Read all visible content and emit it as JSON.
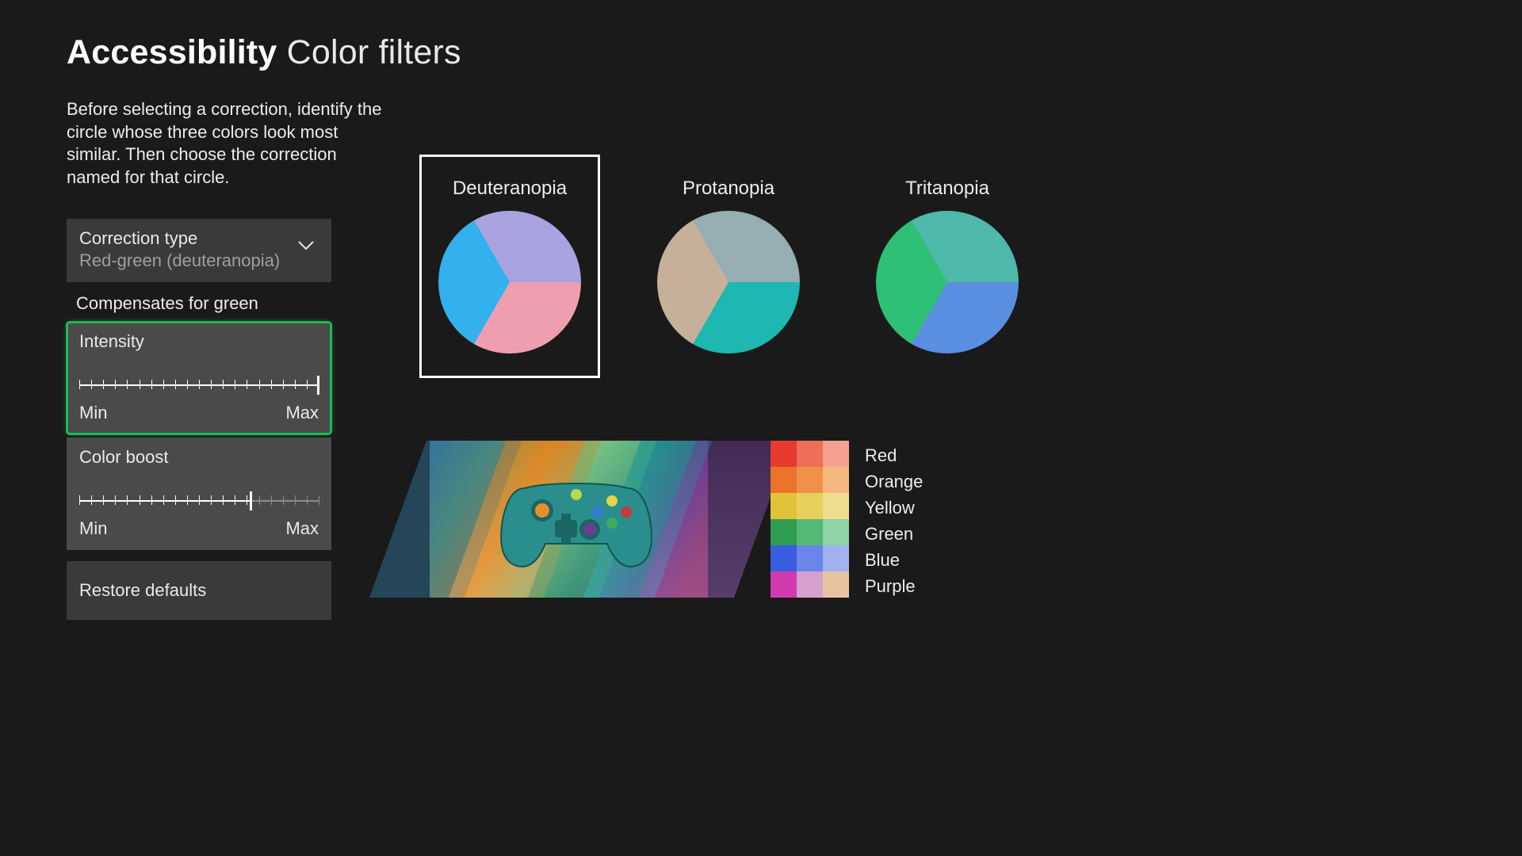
{
  "header": {
    "category": "Accessibility",
    "page": "Color filters"
  },
  "instructions": "Before selecting a correction, identify the circle whose three colors look most similar. Then choose the correction named for that circle.",
  "correction": {
    "label": "Correction type",
    "value": "Red-green (deuteranopia)",
    "description": "Compensates for green"
  },
  "intensity": {
    "label": "Intensity",
    "min_label": "Min",
    "max_label": "Max",
    "value_percent": 100,
    "selected": true
  },
  "color_boost": {
    "label": "Color boost",
    "min_label": "Min",
    "max_label": "Max",
    "value_percent": 72,
    "selected": false
  },
  "restore_label": "Restore defaults",
  "filters": [
    {
      "name": "Deuteranopia",
      "selected": true,
      "colors": [
        "#32b1ee",
        "#a9a4df",
        "#ef9eb0"
      ]
    },
    {
      "name": "Protanopia",
      "selected": false,
      "colors": [
        "#c7b09a",
        "#96adb2",
        "#1fb7b2"
      ]
    },
    {
      "name": "Tritanopia",
      "selected": false,
      "colors": [
        "#2ec076",
        "#4fb9a9",
        "#5a8ee0"
      ]
    }
  ],
  "swatches": {
    "rows": [
      {
        "label": "Red",
        "cells": [
          "#e63b2e",
          "#ef6e5a",
          "#f4a08f"
        ]
      },
      {
        "label": "Orange",
        "cells": [
          "#e9742a",
          "#f09149",
          "#f5b87e"
        ]
      },
      {
        "label": "Yellow",
        "cells": [
          "#e0c33a",
          "#e8d05d",
          "#efdd8e"
        ]
      },
      {
        "label": "Green",
        "cells": [
          "#2f9e53",
          "#55b877",
          "#8ed3a5"
        ]
      },
      {
        "label": "Blue",
        "cells": [
          "#3a5de0",
          "#6b86e8",
          "#a2b2ef"
        ]
      },
      {
        "label": "Purple",
        "cells": [
          "#d23ab0",
          "#d6a1cc",
          "#e7c3a2"
        ]
      }
    ]
  },
  "chart_data": [
    {
      "type": "pie",
      "title": "Deuteranopia",
      "series": [
        {
          "name": "segment-1",
          "values": [
            1
          ],
          "color": "#32b1ee"
        },
        {
          "name": "segment-2",
          "values": [
            1
          ],
          "color": "#a9a4df"
        },
        {
          "name": "segment-3",
          "values": [
            1
          ],
          "color": "#ef9eb0"
        }
      ]
    },
    {
      "type": "pie",
      "title": "Protanopia",
      "series": [
        {
          "name": "segment-1",
          "values": [
            1
          ],
          "color": "#c7b09a"
        },
        {
          "name": "segment-2",
          "values": [
            1
          ],
          "color": "#96adb2"
        },
        {
          "name": "segment-3",
          "values": [
            1
          ],
          "color": "#1fb7b2"
        }
      ]
    },
    {
      "type": "pie",
      "title": "Tritanopia",
      "series": [
        {
          "name": "segment-1",
          "values": [
            1
          ],
          "color": "#2ec076"
        },
        {
          "name": "segment-2",
          "values": [
            1
          ],
          "color": "#4fb9a9"
        },
        {
          "name": "segment-3",
          "values": [
            1
          ],
          "color": "#5a8ee0"
        }
      ]
    }
  ]
}
